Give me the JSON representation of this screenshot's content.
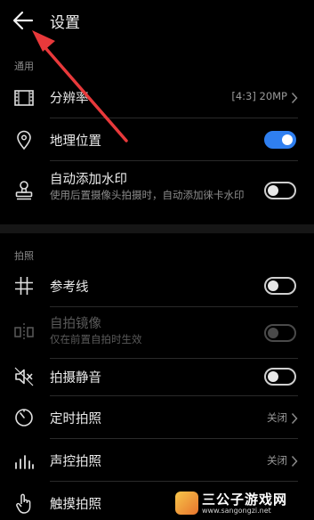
{
  "header": {
    "title": "设置"
  },
  "sections": {
    "general": "通用",
    "shooting": "拍照"
  },
  "rows": {
    "resolution": {
      "label": "分辨率",
      "value": "[4:3] 20MP"
    },
    "location": {
      "label": "地理位置",
      "toggle_on": true
    },
    "watermark": {
      "label": "自动添加水印",
      "sub": "使用后置摄像头拍摄时，自动添加徕卡水印",
      "toggle_on": false
    },
    "gridline": {
      "label": "参考线",
      "toggle_on": false
    },
    "selfie_mirror": {
      "label": "自拍镜像",
      "sub": "仅在前置自拍时生效",
      "toggle_on": false,
      "disabled": true
    },
    "mute": {
      "label": "拍摄静音",
      "toggle_on": false
    },
    "timer": {
      "label": "定时拍照",
      "value": "关闭"
    },
    "voice": {
      "label": "声控拍照",
      "value": "关闭"
    },
    "touch": {
      "label": "触摸拍照"
    }
  },
  "site_watermark": {
    "name": "三公子游戏网",
    "url": "www.sangongzi.net"
  },
  "colors": {
    "accent": "#2f7ff0",
    "annotation_arrow": "#e8393b",
    "background": "#000000"
  }
}
